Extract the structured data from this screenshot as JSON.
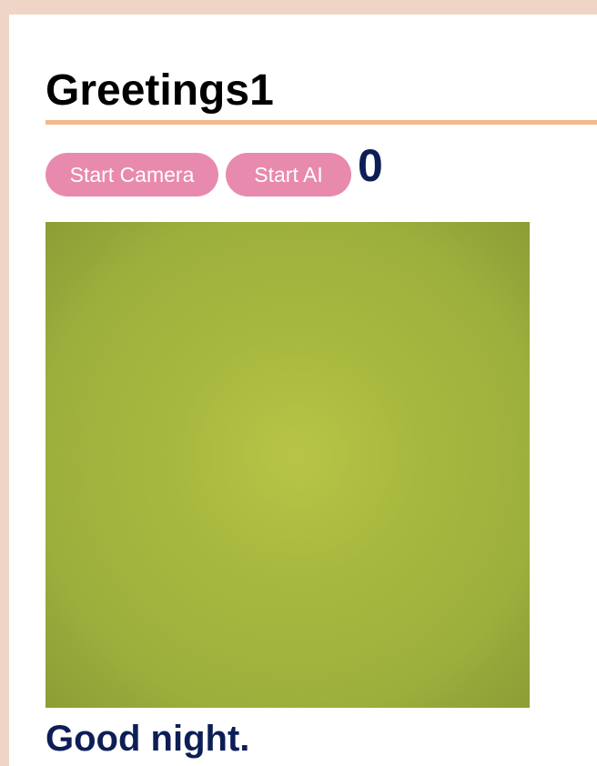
{
  "header": {
    "title": "Greetings1"
  },
  "controls": {
    "start_camera_label": "Start Camera",
    "start_ai_label": "Start AI",
    "counter": "0"
  },
  "output": {
    "greeting": "Good night."
  },
  "colors": {
    "page_border": "#efd5c6",
    "title_rule": "#f3b98a",
    "button_bg": "#e78aad",
    "counter_text": "#0d1e57",
    "camera_feed": "#a9b842"
  }
}
